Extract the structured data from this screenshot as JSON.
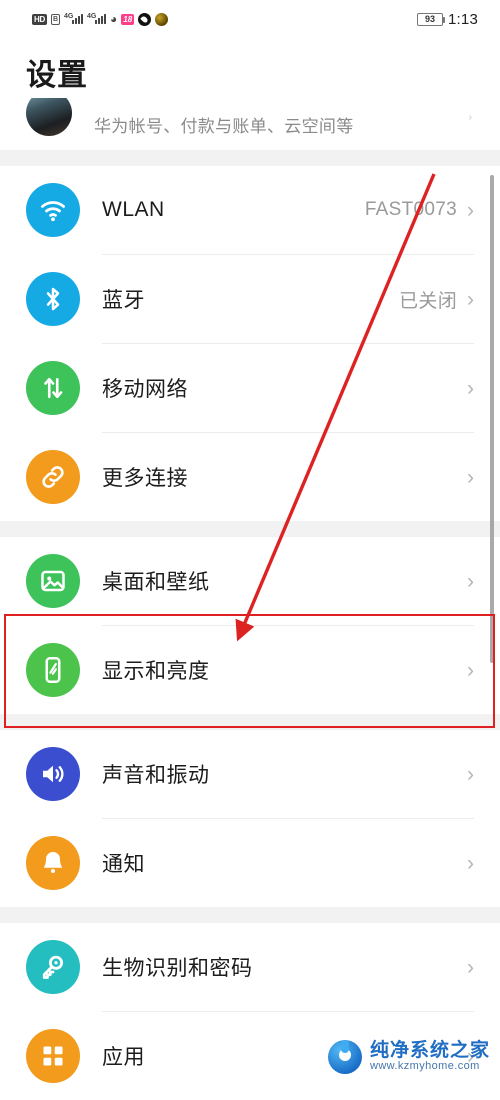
{
  "status_bar": {
    "hd_label": "HD",
    "sim_label": "B",
    "network_generation_1": "4G",
    "network_generation_2": "4G",
    "wifi_icon": "wifi-icon",
    "pink_badge_label": "18",
    "battery_level": "93",
    "time": "1:13"
  },
  "header": {
    "title": "设置"
  },
  "account": {
    "subtitle": "华为帐号、付款与账单、云空间等",
    "chevron": "›"
  },
  "groups": [
    {
      "items": [
        {
          "label": "WLAN",
          "value": "FAST0073",
          "icon": "wifi-icon",
          "color": "#15aae4",
          "chevron": "›"
        },
        {
          "label": "蓝牙",
          "value": "已关闭",
          "icon": "bluetooth-icon",
          "color": "#15aae4",
          "chevron": "›"
        },
        {
          "label": "移动网络",
          "value": "",
          "icon": "data-transfer-icon",
          "color": "#3ec25a",
          "chevron": "›"
        },
        {
          "label": "更多连接",
          "value": "",
          "icon": "link-icon",
          "color": "#f29b1d",
          "chevron": "›"
        }
      ]
    },
    {
      "items": [
        {
          "label": "桌面和壁纸",
          "value": "",
          "icon": "image-icon",
          "color": "#3ec25a",
          "chevron": "›"
        },
        {
          "label": "显示和亮度",
          "value": "",
          "icon": "brightness-phone-icon",
          "color": "#4cc44c",
          "chevron": "›"
        }
      ]
    },
    {
      "items": [
        {
          "label": "声音和振动",
          "value": "",
          "icon": "speaker-icon",
          "color": "#3b4ecf",
          "chevron": "›"
        },
        {
          "label": "通知",
          "value": "",
          "icon": "bell-icon",
          "color": "#f29b1d",
          "chevron": "›"
        }
      ]
    },
    {
      "items": [
        {
          "label": "生物识别和密码",
          "value": "",
          "icon": "key-icon",
          "color": "#24bdc0",
          "chevron": "›"
        },
        {
          "label": "应用",
          "value": "",
          "icon": "grid-icon",
          "color": "#f29b1d",
          "chevron": "›"
        }
      ]
    }
  ],
  "annotations": {
    "highlight_color": "#e02020",
    "highlight_target": "显示和亮度",
    "arrow_color": "#dd2222"
  },
  "watermark": {
    "site_name": "纯净系统之家",
    "url": "www.kzmyhome.com"
  }
}
